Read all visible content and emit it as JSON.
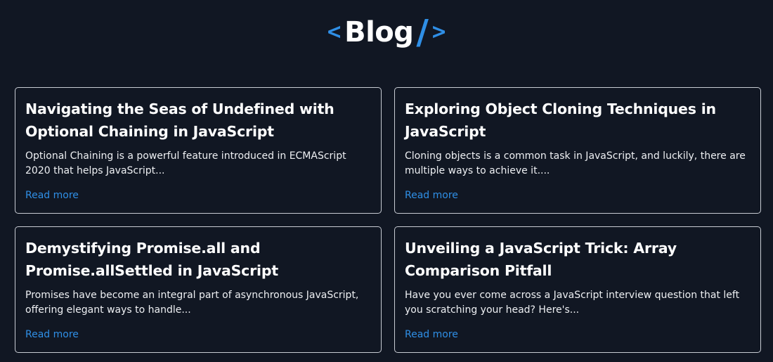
{
  "header": {
    "logo_left": "<",
    "logo_text": "Blog",
    "logo_slash": "/",
    "logo_right": ">",
    "accent_color": "#2f8fe6"
  },
  "posts": [
    {
      "title": "Navigating the Seas of Undefined with Optional Chaining in JavaScript",
      "excerpt": "Optional Chaining is a powerful feature introduced in ECMAScript 2020 that helps JavaScript...",
      "link_label": "Read more"
    },
    {
      "title": "Exploring Object Cloning Techniques in JavaScript",
      "excerpt": "Cloning objects is a common task in JavaScript, and luckily, there are multiple ways to achieve it....",
      "link_label": "Read more"
    },
    {
      "title": "Demystifying Promise.all and Promise.allSettled in JavaScript",
      "excerpt": "Promises have become an integral part of asynchronous JavaScript, offering elegant ways to handle...",
      "link_label": "Read more"
    },
    {
      "title": "Unveiling a JavaScript Trick: Array Comparison Pitfall",
      "excerpt": "Have you ever come across a JavaScript interview question that left you scratching your head? Here's...",
      "link_label": "Read more"
    }
  ]
}
